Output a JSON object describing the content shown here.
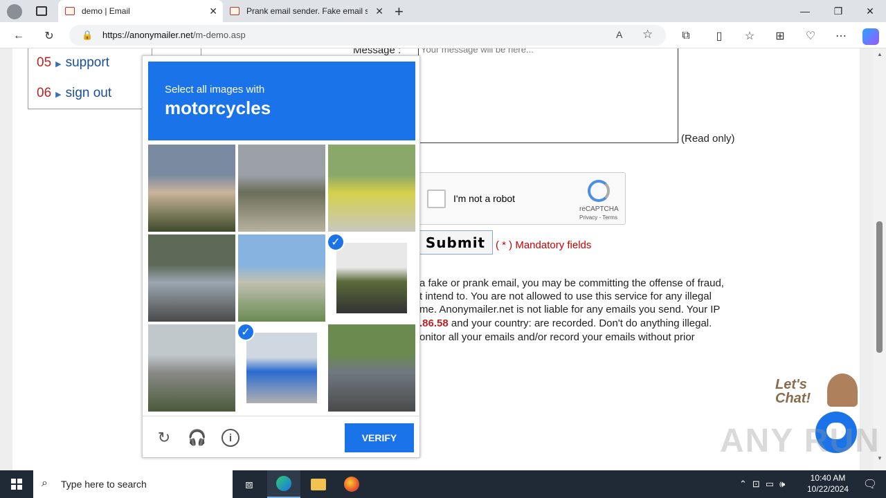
{
  "browser": {
    "tabs": [
      {
        "title": "demo | Email",
        "active": true
      },
      {
        "title": "Prank email sender. Fake email se",
        "active": false
      }
    ],
    "url_domain": "https://anonymailer.net",
    "url_path": "/m-demo.asp",
    "window_controls": {
      "minimize": "—",
      "restore": "❐",
      "close": "✕"
    }
  },
  "sidebar": {
    "items": [
      {
        "num": "05",
        "label": "support"
      },
      {
        "num": "06",
        "label": "sign out"
      }
    ]
  },
  "form": {
    "message_label": "Message :",
    "message_placeholder": "Your message will be here...",
    "read_only": "(Read only)",
    "recaptcha": {
      "label": "I'm not a robot",
      "brand": "reCAPTCHA",
      "links": "Privacy - Terms"
    },
    "submit": "Submit",
    "mandatory": "( * ) Mandatory fields"
  },
  "disclaimer": {
    "line1": "a fake or prank email, you may be committing the offense of fraud,",
    "line2": "t intend to. You are not allowed to use this service for any illegal",
    "line3": "me. Anonymailer.net is not liable for any emails you send. Your IP",
    "line4_ip": ".86.58",
    "line4_rest": " and your country: are recorded. Don't do anything illegal.",
    "line5": "onitor all your emails and/or record your emails without prior"
  },
  "captcha": {
    "instruction": "Select all images with",
    "target": "motorcycles",
    "verify": "VERIFY",
    "tiles": [
      {
        "scene": "street",
        "selected": false,
        "colors": [
          "#7a8aa0",
          "#c9b49a",
          "#3e4b2a"
        ]
      },
      {
        "scene": "bare-tree",
        "selected": false,
        "colors": [
          "#9aa0a6",
          "#6b6e5a",
          "#b8b2a0"
        ]
      },
      {
        "scene": "flower-bed",
        "selected": false,
        "colors": [
          "#8aa86a",
          "#d4d04a",
          "#c8c8c0"
        ]
      },
      {
        "scene": "parked-scooters",
        "selected": false,
        "colors": [
          "#5d6a58",
          "#9aa6b0",
          "#4a4a4a"
        ]
      },
      {
        "scene": "intersection",
        "selected": false,
        "colors": [
          "#87b3e0",
          "#c0c0b0",
          "#6a8a50"
        ]
      },
      {
        "scene": "dirt-bike",
        "selected": true,
        "colors": [
          "#e8e8e8",
          "#5a6a3a",
          "#333333"
        ]
      },
      {
        "scene": "road-rider",
        "selected": false,
        "colors": [
          "#c0c8cc",
          "#8a8a88",
          "#4a5a3a"
        ]
      },
      {
        "scene": "scooter-rider",
        "selected": true,
        "colors": [
          "#cfd8e0",
          "#2a6bd0",
          "#b0b0b0"
        ]
      },
      {
        "scene": "market-stall",
        "selected": false,
        "colors": [
          "#6a8a50",
          "#707880",
          "#4a4a4a"
        ]
      }
    ],
    "footer_icons": [
      "refresh-icon",
      "headphones-icon",
      "info-icon"
    ]
  },
  "chat": {
    "label": "Let's\nChat!"
  },
  "watermark": "ANY RUN",
  "taskbar": {
    "search_placeholder": "Type here to search",
    "time": "10:40 AM",
    "date": "10/22/2024"
  }
}
